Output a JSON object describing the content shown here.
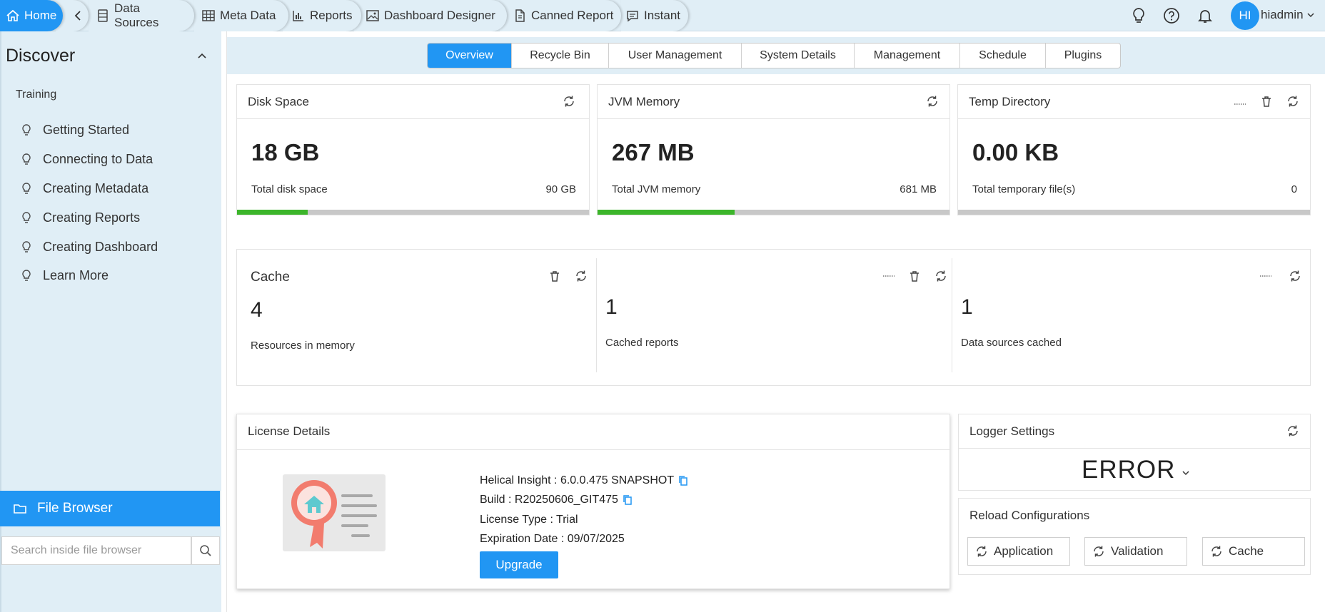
{
  "nav": {
    "home": "Home",
    "back_icon": "chevron-left-icon",
    "items": [
      {
        "label": "Data Sources",
        "icon": "data-sources-icon"
      },
      {
        "label": "Meta Data",
        "icon": "table-grid-icon"
      },
      {
        "label": "Reports",
        "icon": "bar-chart-icon"
      },
      {
        "label": "Dashboard Designer",
        "icon": "image-icon"
      },
      {
        "label": "Canned Report",
        "icon": "document-icon"
      },
      {
        "label": "Instant",
        "icon": "chat-icon"
      }
    ],
    "user_initials": "HI",
    "username": "hiadmin"
  },
  "sidebar": {
    "title": "Discover",
    "section": "Training",
    "items": [
      {
        "label": "Getting Started"
      },
      {
        "label": "Connecting to Data"
      },
      {
        "label": "Creating Metadata"
      },
      {
        "label": "Creating Reports"
      },
      {
        "label": "Creating Dashboard"
      },
      {
        "label": "Learn More"
      }
    ],
    "file_browser": "File Browser",
    "search_placeholder": "Search inside file browser"
  },
  "tabs": [
    "Overview",
    "Recycle Bin",
    "User Management",
    "System Details",
    "Management",
    "Schedule",
    "Plugins"
  ],
  "active_tab": "Overview",
  "disk": {
    "title": "Disk Space",
    "value": "18 GB",
    "label": "Total disk space",
    "total": "90 GB",
    "progress": 0.2
  },
  "jvm": {
    "title": "JVM Memory",
    "value": "267 MB",
    "label": "Total JVM memory",
    "total": "681 MB",
    "progress": 0.39
  },
  "temp": {
    "title": "Temp Directory",
    "value": "0.00 KB",
    "label": "Total temporary file(s)",
    "total": "0",
    "progress": 0
  },
  "cache": {
    "title": "Cache",
    "resources": {
      "value": "4",
      "label": "Resources in memory"
    },
    "reports": {
      "value": "1",
      "label": "Cached reports"
    },
    "datasources": {
      "value": "1",
      "label": "Data sources cached"
    }
  },
  "license": {
    "title": "License Details",
    "product": "Helical Insight : 6.0.0.475 SNAPSHOT",
    "build": "Build : R20250606_GIT475",
    "type": "License Type : Trial",
    "expiration": "Expiration Date : 09/07/2025",
    "upgrade": "Upgrade"
  },
  "logger": {
    "title": "Logger Settings",
    "level": "ERROR"
  },
  "reload": {
    "title": "Reload Configurations",
    "buttons": [
      "Application",
      "Validation",
      "Cache"
    ]
  },
  "colors": {
    "accent": "#2196f3",
    "sidebar_bg": "#e0eef6",
    "progress": "#3cb52a",
    "badge": "#f27c6e",
    "badge_house": "#5fc9cf"
  }
}
